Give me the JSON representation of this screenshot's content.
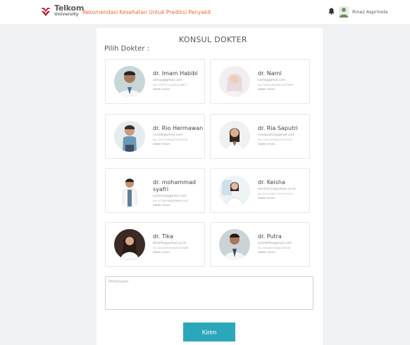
{
  "header": {
    "logo_line1": "Telkom",
    "logo_line2": "University",
    "app_title": "Rekomendasi Kesehatan Untuk Prediksi Penyakit",
    "username": "Rinez Asprinola"
  },
  "main": {
    "title": "KONSUL DOKTER",
    "pilih_label": "Pilih Dokter :"
  },
  "doctors": [
    {
      "name": "dr. Imam Habibi",
      "email": "ushop@gmail.com",
      "phone": "Hp. 0787871xxx811xx8811",
      "specialty": "Dokter Umum"
    },
    {
      "name": "dr. Nami",
      "email": "nami@gmail.com",
      "phone": "Hp. 0x8x7x8xxx811x229990",
      "specialty": "Dokter Umum"
    },
    {
      "name": "dr. Rio Hermawan",
      "email": "rio100@ymail.com",
      "phone": "Hp. 12311291x621x191292",
      "specialty": "Dokter Umum"
    },
    {
      "name": "dr. Ria Saputri",
      "email": "riasaputri2@gmail.com",
      "phone": "Hp. 12311291x621x191292",
      "specialty": "Dokter Umum"
    },
    {
      "name": "dr. mohammad syafri",
      "email": "syafrims@gmail.com",
      "phone": "Hp. 0778008888888887xx8",
      "specialty": "Dokter Umum"
    },
    {
      "name": "dr. Keisha",
      "email": "keisha123@yahoo.co.id",
      "phone": "Hp. 8x7x7x8x7x7x7x7x7x7x",
      "specialty": "Dokter Umum"
    },
    {
      "name": "dr. Tika",
      "email": "tikak9x@yahoo.co.id",
      "phone": "Hp. 0x0x0x9x9x9x9x7xx888",
      "specialty": "Dokter Umum"
    },
    {
      "name": "dr. Putra",
      "email": "putrak9x@gmail.com",
      "phone": "Hp. 0x0x8x7x8x8x7x8xx8",
      "specialty": "Dokter Umum"
    }
  ],
  "form": {
    "question_placeholder": "Pertanyaan",
    "submit_label": "Kirim"
  },
  "colors": {
    "accent": "#2aa7b9",
    "title_orange": "#e0703a",
    "logo_red": "#c8202f"
  },
  "icons": [
    "telkom-logo-icon",
    "bell-icon",
    "user-avatar-icon"
  ]
}
